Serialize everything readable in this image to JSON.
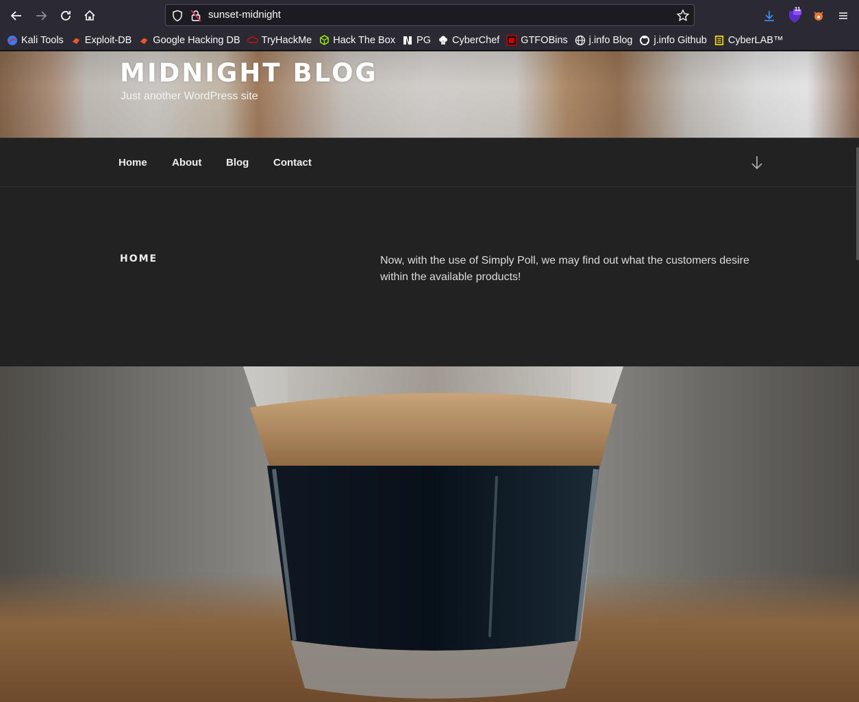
{
  "browser": {
    "url": "sunset-midnight",
    "nav": {
      "back_icon": "arrow-left-icon",
      "forward_icon": "arrow-right-icon",
      "reload_icon": "reload-icon",
      "home_icon": "home-icon"
    },
    "toolbar_right": {
      "downloads_icon": "download-icon",
      "extension_badge": "11",
      "menu_icon": "hamburger-menu-icon"
    }
  },
  "bookmarks": [
    {
      "label": "Kali Tools",
      "icon": "kali-icon",
      "color": "#367bf0"
    },
    {
      "label": "Exploit-DB",
      "icon": "exploit-db-icon",
      "color": "#e8562a"
    },
    {
      "label": "Google Hacking DB",
      "icon": "ghdb-icon",
      "color": "#e8562a"
    },
    {
      "label": "TryHackMe",
      "icon": "tryhackme-icon",
      "color": "#c11111"
    },
    {
      "label": "Hack The Box",
      "icon": "htb-icon",
      "color": "#9fef00"
    },
    {
      "label": "PG",
      "icon": "pg-icon",
      "color": "#ffffff"
    },
    {
      "label": "CyberChef",
      "icon": "chef-hat-icon",
      "color": "#ffffff"
    },
    {
      "label": "GTFOBins",
      "icon": "gtfobins-icon",
      "color": "#cc0000"
    },
    {
      "label": "j.info Blog",
      "icon": "globe-icon",
      "color": "#ffffff"
    },
    {
      "label": "j.info Github",
      "icon": "github-icon",
      "color": "#ffffff"
    },
    {
      "label": "CyberLAB™",
      "icon": "cyberlab-icon",
      "color": "#f5d90a"
    }
  ],
  "site": {
    "title": "MIDNIGHT BLOG",
    "description": "Just another WordPress site",
    "menu": [
      "Home",
      "About",
      "Blog",
      "Contact"
    ],
    "scroll_icon": "arrow-down-icon"
  },
  "page": {
    "heading": "HOME",
    "text": "Now, with the use of Simply Poll, we may find out what the customers desire within the available products!"
  }
}
